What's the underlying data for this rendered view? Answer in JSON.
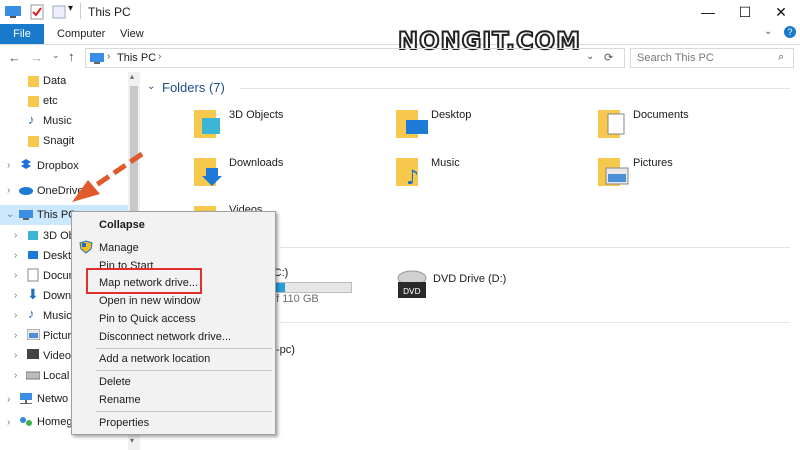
{
  "window": {
    "title": "This PC"
  },
  "ribbon": {
    "tabs": [
      "File",
      "Computer",
      "View"
    ]
  },
  "address": {
    "path": "This PC"
  },
  "search": {
    "placeholder": "Search This PC"
  },
  "watermark": "NONGIT.COM",
  "nav": {
    "items": [
      {
        "label": "Data",
        "icon": "folder-icon"
      },
      {
        "label": "etc",
        "icon": "folder-icon"
      },
      {
        "label": "Music",
        "icon": "music-icon"
      },
      {
        "label": "Snagit",
        "icon": "folder-icon"
      },
      {
        "label": "Dropbox",
        "icon": "dropbox-icon"
      },
      {
        "label": "OneDrive",
        "icon": "cloud-icon"
      },
      {
        "label": "This PC",
        "icon": "computer-icon"
      },
      {
        "label": "3D Obj",
        "icon": "cube-icon"
      },
      {
        "label": "Deskto",
        "icon": "desktop-icon"
      },
      {
        "label": "Docum",
        "icon": "document-icon"
      },
      {
        "label": "Downl",
        "icon": "download-icon"
      },
      {
        "label": "Music",
        "icon": "music-icon"
      },
      {
        "label": "Picture",
        "icon": "picture-icon"
      },
      {
        "label": "Videos",
        "icon": "video-icon"
      },
      {
        "label": "Local D",
        "icon": "drive-icon"
      },
      {
        "label": "Netwo",
        "icon": "network-icon"
      },
      {
        "label": "Homegr",
        "icon": "homegroup-icon"
      }
    ]
  },
  "main": {
    "folders_header": "Folders (7)",
    "folders": [
      {
        "label": "3D Objects"
      },
      {
        "label": "Desktop"
      },
      {
        "label": "Documents"
      },
      {
        "label": "Downloads"
      },
      {
        "label": "Music"
      },
      {
        "label": "Pictures"
      },
      {
        "label": "Videos"
      }
    ],
    "drive_c_label_partial": "(C:)",
    "drive_c_space_partial": "of 110 GB",
    "drive_c_used_fraction": 0.18,
    "dvd_label": "DVD Drive (D:)",
    "dvd_badge": "DVD",
    "network_partial": "-pc)"
  },
  "context_menu": {
    "items": [
      "Collapse",
      "Manage",
      "Pin to Start",
      "Map network drive...",
      "Open in new window",
      "Pin to Quick access",
      "Disconnect network drive...",
      "Add a network location",
      "Delete",
      "Rename",
      "Properties"
    ]
  },
  "colors": {
    "accent": "#1979ca",
    "highlight_box": "#e03030",
    "arrow": "#e05a2b",
    "folder": "#f6c84b"
  }
}
